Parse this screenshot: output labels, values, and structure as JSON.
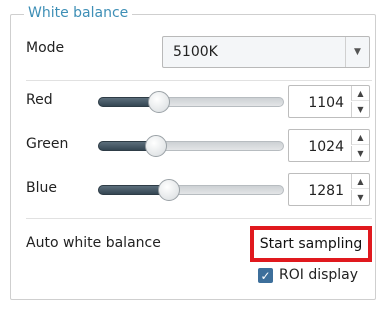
{
  "group": {
    "title": "White balance"
  },
  "mode": {
    "label": "Mode",
    "value": "5100K"
  },
  "sliders": [
    {
      "label": "Red",
      "value": "1104",
      "level": 0.27
    },
    {
      "label": "Green",
      "value": "1024",
      "level": 0.25
    },
    {
      "label": "Blue",
      "value": "1281",
      "level": 0.32
    }
  ],
  "auto_wb": {
    "label": "Auto white balance",
    "button_label": "Start sampling"
  },
  "roi": {
    "label": "ROI display",
    "checked": true
  },
  "icons": {
    "spin_up": "chevron-up-icon",
    "spin_down": "chevron-down-icon",
    "combo": "dropdown-arrow-icon",
    "check": "check-icon"
  },
  "colors": {
    "title": "#3e8fb6",
    "highlight": "#e0191e",
    "checkbox": "#3d6f9b",
    "slider_fill": "#354753"
  }
}
